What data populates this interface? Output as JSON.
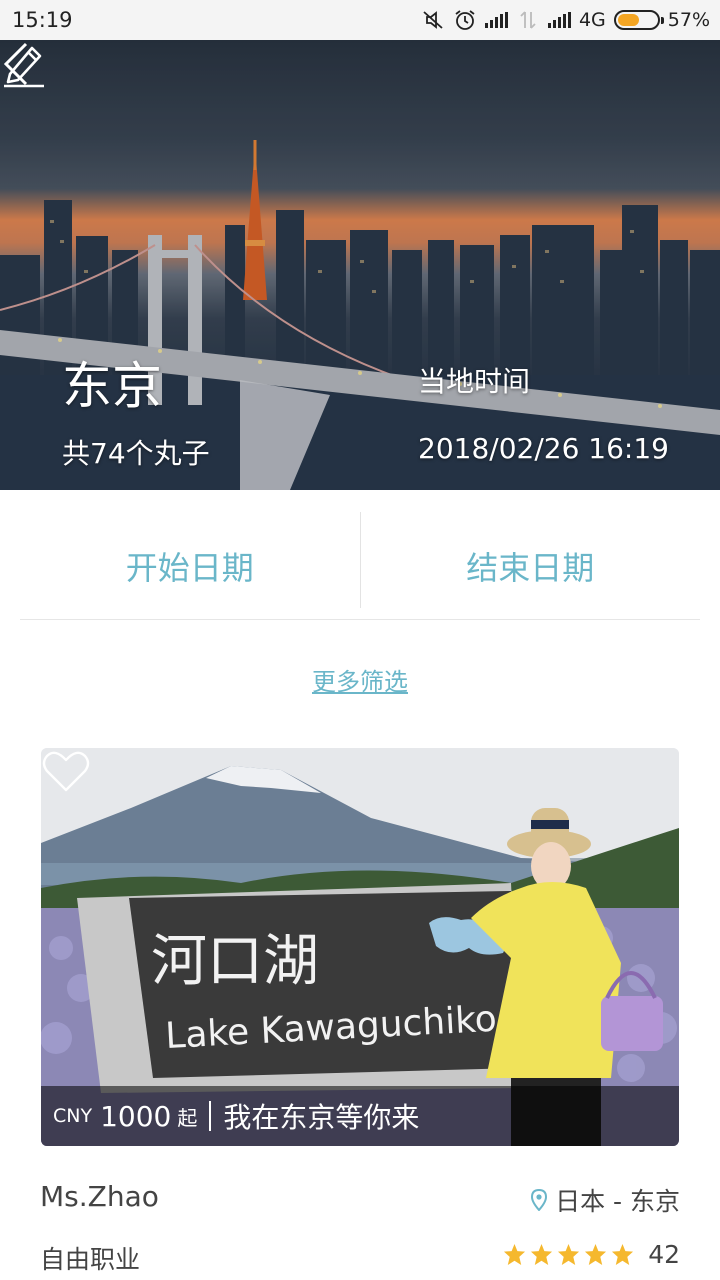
{
  "status_bar": {
    "time": "15:19",
    "network": "4G",
    "battery": "57%",
    "battery_level": 0.57,
    "battery_color": "#f5a623"
  },
  "hero": {
    "city": "东京",
    "count_text": "共74个丸子",
    "local_time_label": "当地时间",
    "local_time": "2018/02/26 16:19",
    "back_icon": "back-chevron-icon",
    "edit_icon": "pencil-edit-icon"
  },
  "filters": {
    "start_date": "开始日期",
    "end_date": "结束日期",
    "more": "更多筛选",
    "accent_color": "#6ab6c9"
  },
  "listing": {
    "currency": "CNY",
    "price": "1000",
    "price_suffix": "起",
    "title": "我在东京等你来",
    "sign_text_cn": "河口湖",
    "sign_text_en": "Lake Kawaguchiko",
    "favorite_icon": "heart-outline-icon",
    "host_name": "Ms.Zhao",
    "host_job": "自由职业",
    "location": "日本 - 东京",
    "rating_stars": 5,
    "rating_count": "42",
    "star_color": "#f5b82e",
    "pin_color": "#6ab6c9"
  }
}
